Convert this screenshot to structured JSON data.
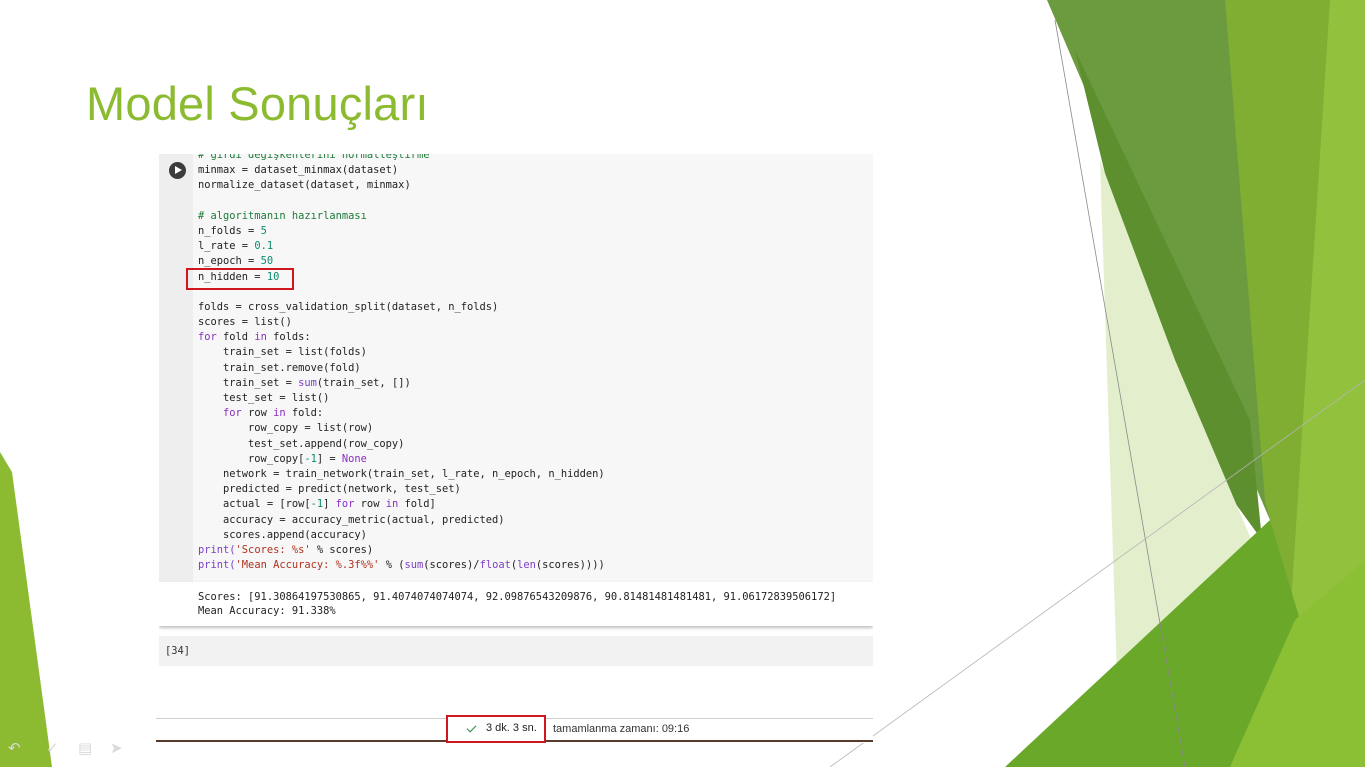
{
  "slide": {
    "title": "Model Sonuçları",
    "accent_color": "#8cbb31"
  },
  "notebook": {
    "code_lines": [
      [
        {
          "t": "# girdi değişkenlerini normalleştirme",
          "c": "comment"
        }
      ],
      [
        {
          "t": "minmax = dataset_minmax(dataset)"
        }
      ],
      [
        {
          "t": "normalize_dataset(dataset, minmax)"
        }
      ],
      [],
      [
        {
          "t": "# algoritmanın hazırlanması",
          "c": "comment"
        }
      ],
      [
        {
          "t": "n_folds = "
        },
        {
          "t": "5",
          "c": "num"
        }
      ],
      [
        {
          "t": "l_rate = "
        },
        {
          "t": "0.1",
          "c": "num"
        }
      ],
      [
        {
          "t": "n_epoch = "
        },
        {
          "t": "50",
          "c": "num"
        }
      ],
      [
        {
          "t": "n_hidden = "
        },
        {
          "t": "10",
          "c": "num"
        }
      ],
      [],
      [
        {
          "t": "folds = cross_validation_split(dataset, n_folds)"
        }
      ],
      [
        {
          "t": "scores = list()"
        }
      ],
      [
        {
          "t": "for",
          "c": "kw"
        },
        {
          "t": " fold "
        },
        {
          "t": "in",
          "c": "kw"
        },
        {
          "t": " folds:"
        }
      ],
      [
        {
          "t": "    train_set = list(folds)"
        }
      ],
      [
        {
          "t": "    train_set.remove(fold)"
        }
      ],
      [
        {
          "t": "    train_set = "
        },
        {
          "t": "sum",
          "c": "bi"
        },
        {
          "t": "(train_set, [])"
        }
      ],
      [
        {
          "t": "    test_set = list()"
        }
      ],
      [
        {
          "t": "    "
        },
        {
          "t": "for",
          "c": "kw"
        },
        {
          "t": " row "
        },
        {
          "t": "in",
          "c": "kw"
        },
        {
          "t": " fold:"
        }
      ],
      [
        {
          "t": "        row_copy = list(row)"
        }
      ],
      [
        {
          "t": "        test_set.append(row_copy)"
        }
      ],
      [
        {
          "t": "        row_copy["
        },
        {
          "t": "-1",
          "c": "num"
        },
        {
          "t": "] = "
        },
        {
          "t": "None",
          "c": "kw"
        }
      ],
      [
        {
          "t": "    network = train_network(train_set, l_rate, n_epoch, n_hidden)"
        }
      ],
      [
        {
          "t": "    predicted = predict(network, test_set)"
        }
      ],
      [
        {
          "t": "    actual = [row["
        },
        {
          "t": "-1",
          "c": "num"
        },
        {
          "t": "] "
        },
        {
          "t": "for",
          "c": "kw"
        },
        {
          "t": " row "
        },
        {
          "t": "in",
          "c": "kw"
        },
        {
          "t": " fold]"
        }
      ],
      [
        {
          "t": "    accuracy = accuracy_metric(actual, predicted)"
        }
      ],
      [
        {
          "t": "    scores.append(accuracy)"
        }
      ],
      [
        {
          "t": "print(",
          "c": "bi"
        },
        {
          "t": "'Scores: %s'",
          "c": "str"
        },
        {
          "t": " % scores)"
        }
      ],
      [
        {
          "t": "print(",
          "c": "bi"
        },
        {
          "t": "'Mean Accuracy: %.3f%%'",
          "c": "str"
        },
        {
          "t": " % ("
        },
        {
          "t": "sum",
          "c": "bi"
        },
        {
          "t": "(scores)/"
        },
        {
          "t": "float",
          "c": "bi"
        },
        {
          "t": "("
        },
        {
          "t": "len",
          "c": "bi"
        },
        {
          "t": "(scores))))"
        }
      ]
    ],
    "output_lines": [
      "Scores: [91.30864197530865, 91.4074074074074, 92.09876543209876, 90.81481481481481, 91.06172839506172]",
      "Mean Accuracy: 91.338%"
    ],
    "execution_count": "[34]"
  },
  "status_bar": {
    "duration": "3 dk. 3 sn.",
    "completion": "tamamlanma zamanı: 09:16"
  },
  "nav_icons": [
    "back-arrow-icon",
    "pen-icon",
    "menu-icon",
    "forward-arrow-icon"
  ]
}
